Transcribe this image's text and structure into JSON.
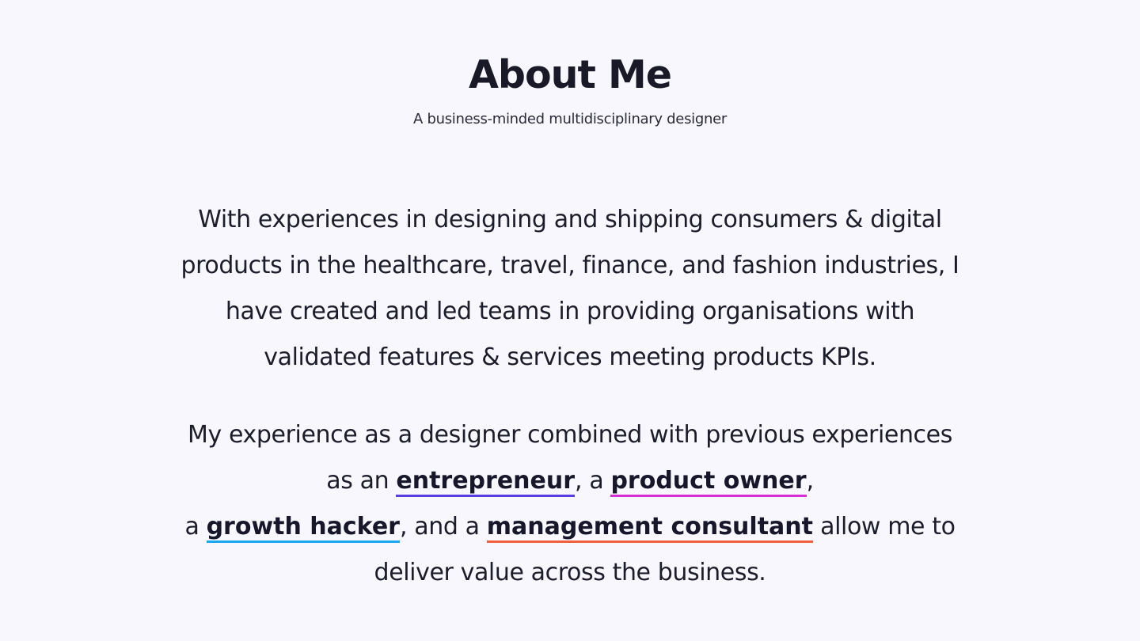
{
  "header": {
    "title": "About Me",
    "subtitle": "A business-minded multidisciplinary designer"
  },
  "paragraph_1": {
    "text": "With experiences in designing and shipping consumers & digital products in the healthcare, travel, finance, and fashion industries, I have created and led teams in providing organisations with validated features & services meeting products KPIs."
  },
  "paragraph_2": {
    "part_1": "My experience as a designer combined with previous experiences as an ",
    "part_2": ", a ",
    "part_3": ",",
    "part_4": "a ",
    "part_5": ", and a ",
    "part_6": " allow me to deliver value across the business.",
    "links": {
      "entrepreneur": "entrepreneur",
      "product_owner": "product owner",
      "growth_hacker": "growth hacker",
      "management_consultant": "management consultant"
    }
  },
  "colors": {
    "background": "#f7f7fd",
    "text": "#1c1b2b",
    "entrepreneur_underline": "#5a3fe0",
    "product_owner_underline": "#d62fd6",
    "growth_hacker_underline": "#1ba7f0",
    "management_consultant_underline": "#f0603e"
  }
}
